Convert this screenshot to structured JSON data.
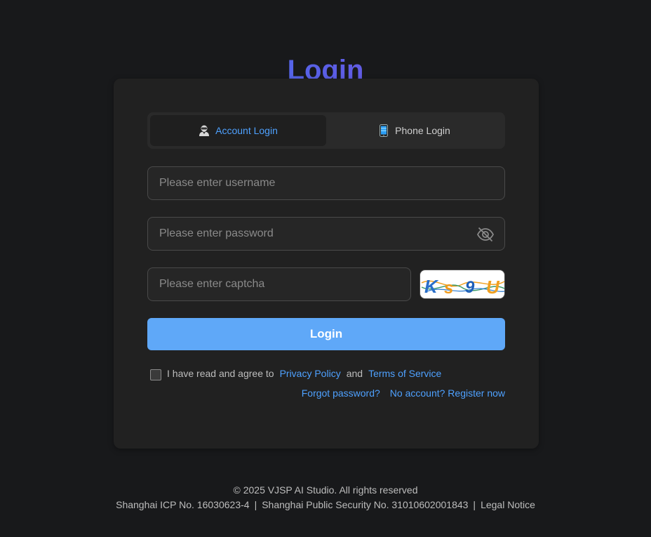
{
  "page": {
    "title": "Login"
  },
  "tabs": [
    {
      "label": "Account Login",
      "icon": "user-icon",
      "active": true
    },
    {
      "label": "Phone Login",
      "icon": "phone-icon",
      "active": false
    }
  ],
  "form": {
    "username": {
      "placeholder": "Please enter username",
      "value": ""
    },
    "password": {
      "placeholder": "Please enter password",
      "value": ""
    },
    "captcha": {
      "placeholder": "Please enter captcha",
      "value": "",
      "image_text": "Ks9U"
    }
  },
  "login_button": "Login",
  "agreement": {
    "prefix": "I have read and agree to",
    "privacy": "Privacy Policy",
    "and": "and",
    "terms": "Terms of Service",
    "checked": false
  },
  "links": {
    "forgot": "Forgot password?",
    "register": "No account? Register now"
  },
  "footer": {
    "copyright": "© 2025 VJSP AI Studio. All rights reserved",
    "icp": "Shanghai ICP No. 16030623-4",
    "security": "Shanghai Public Security No. 31010602001843",
    "legal": "Legal Notice",
    "separator": "|"
  },
  "colors": {
    "background": "#18191b",
    "card": "#212121",
    "accent": "#4ea1ff",
    "button": "#5fa8f8",
    "title_gradient": [
      "#2f8ef5",
      "#9a3fd0"
    ]
  }
}
